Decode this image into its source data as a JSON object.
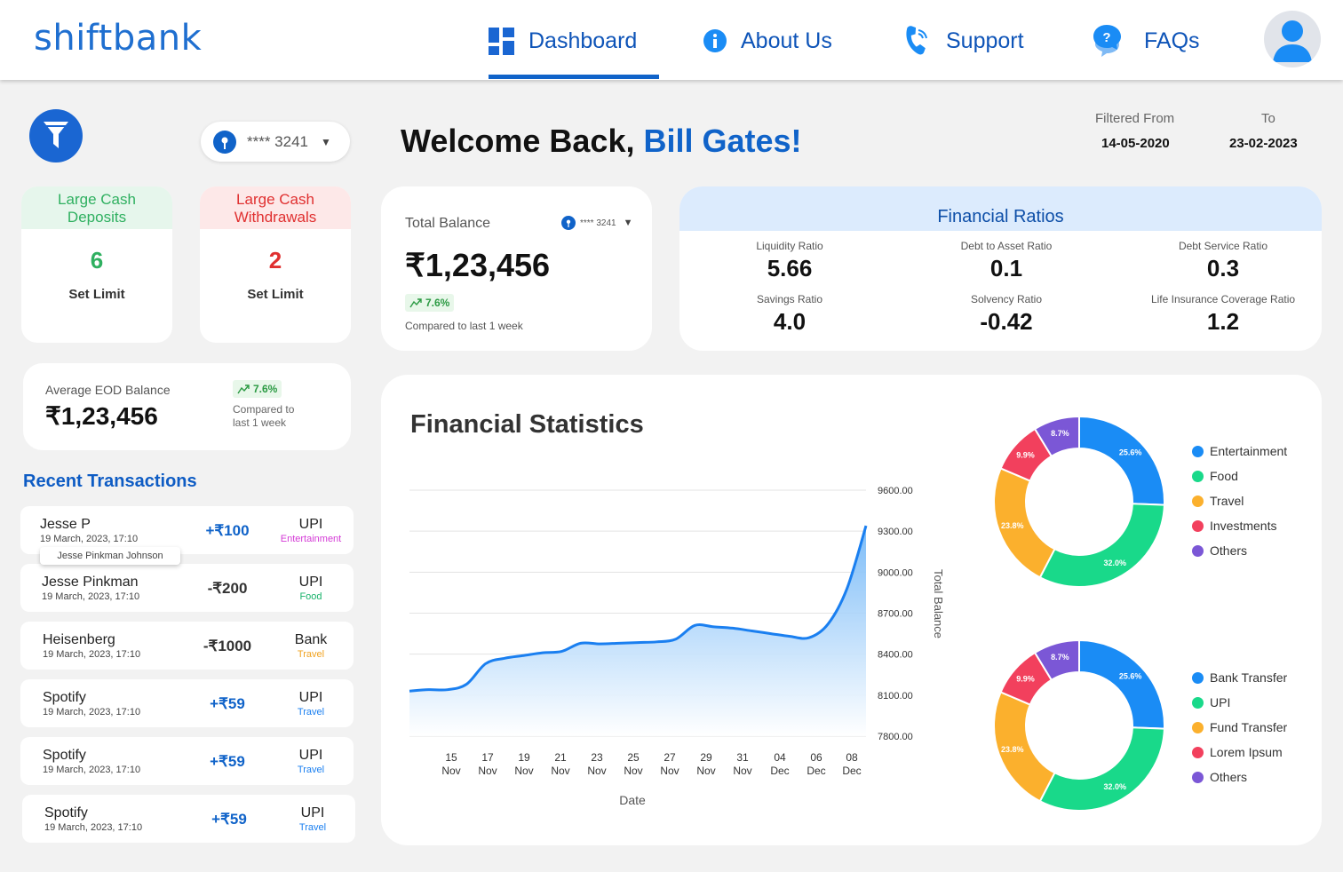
{
  "app": {
    "logo": "shiftbank"
  },
  "nav": {
    "items": [
      {
        "label": "Dashboard",
        "icon": "dashboard-icon",
        "active": true
      },
      {
        "label": "About Us",
        "icon": "info-icon"
      },
      {
        "label": "Support",
        "icon": "phone-icon"
      },
      {
        "label": "FAQs",
        "icon": "faq-icon"
      }
    ]
  },
  "account_select": {
    "value": "**** 3241"
  },
  "limits": {
    "deposits": {
      "title_line1": "Large Cash",
      "title_line2": "Deposits",
      "count": "6",
      "action": "Set Limit",
      "color": "#2fb060",
      "bg": "#e6f6ec"
    },
    "withdrawals": {
      "title_line1": "Large Cash",
      "title_line2": "Withdrawals",
      "count": "2",
      "action": "Set Limit",
      "color": "#e03030",
      "bg": "#fde8e8"
    }
  },
  "eod": {
    "label": "Average EOD Balance",
    "value": "₹1,23,456",
    "change": "7.6%",
    "compare_line1": "Compared to",
    "compare_line2": "last 1 week"
  },
  "recent": {
    "title": "Recent Transactions",
    "tooltip": "Jesse Pinkman Johnson",
    "transactions": [
      {
        "name": "Jesse P",
        "date": "19 March, 2023, 17:10",
        "amount": "+₹100",
        "mode": "UPI",
        "category": "Entertainment",
        "cat_color": "#d43ad6",
        "amt_color": "#1063c9"
      },
      {
        "name": "Jesse Pinkman",
        "date": "19 March, 2023, 17:10",
        "amount": "-₹200",
        "mode": "UPI",
        "category": "Food",
        "cat_color": "#17b26a",
        "amt_color": "#333333"
      },
      {
        "name": "Heisenberg",
        "date": "19 March, 2023, 17:10",
        "amount": "-₹1000",
        "mode": "Bank",
        "category": "Travel",
        "cat_color": "#f0a21f",
        "amt_color": "#333333"
      },
      {
        "name": "Spotify",
        "date": "19 March, 2023, 17:10",
        "amount": "+₹59",
        "mode": "UPI",
        "category": "Travel",
        "cat_color": "#1a7ff0",
        "amt_color": "#1063c9"
      },
      {
        "name": "Spotify",
        "date": "19 March, 2023, 17:10",
        "amount": "+₹59",
        "mode": "UPI",
        "category": "Travel",
        "cat_color": "#1a7ff0",
        "amt_color": "#1063c9"
      },
      {
        "name": "Spotify",
        "date": "19 March, 2023, 17:10",
        "amount": "+₹59",
        "mode": "UPI",
        "category": "Travel",
        "cat_color": "#1a7ff0",
        "amt_color": "#1063c9"
      }
    ]
  },
  "welcome": {
    "prefix": "Welcome Back, ",
    "name": "Bill Gates!"
  },
  "date_filter": {
    "from_label": "Filtered From",
    "to_label": "To",
    "from": "14-05-2020",
    "to": "23-02-2023"
  },
  "balance": {
    "label": "Total Balance",
    "account": "**** 3241",
    "value": "₹1,23,456",
    "change": "7.6%",
    "compare": "Compared to last 1 week"
  },
  "ratios": {
    "title": "Financial Ratios",
    "items": [
      {
        "label": "Liquidity Ratio",
        "value": "5.66"
      },
      {
        "label": "Debt to Asset Ratio",
        "value": "0.1"
      },
      {
        "label": "Debt Service Ratio",
        "value": "0.3"
      },
      {
        "label": "Savings Ratio",
        "value": "4.0"
      },
      {
        "label": "Solvency Ratio",
        "value": "-0.42"
      },
      {
        "label": "Life Insurance Coverage Ratio",
        "value": "1.2"
      }
    ]
  },
  "stats": {
    "title": "Financial Statistics"
  },
  "chart_data": [
    {
      "type": "area",
      "xlabel": "Date",
      "ylabel": "Total Balance",
      "ylim": [
        7800,
        9600
      ],
      "y_ticks": [
        "9600.00",
        "9300.00",
        "9000.00",
        "8700.00",
        "8400.00",
        "8100.00",
        "7800.00"
      ],
      "x_ticks": [
        [
          "15",
          "Nov"
        ],
        [
          "17",
          "Nov"
        ],
        [
          "19",
          "Nov"
        ],
        [
          "21",
          "Nov"
        ],
        [
          "23",
          "Nov"
        ],
        [
          "25",
          "Nov"
        ],
        [
          "27",
          "Nov"
        ],
        [
          "29",
          "Nov"
        ],
        [
          "31",
          "Nov"
        ],
        [
          "04",
          "Dec"
        ],
        [
          "06",
          "Dec"
        ],
        [
          "08",
          "Dec"
        ]
      ],
      "x": [
        14,
        15,
        16,
        17,
        18,
        19,
        20,
        21,
        22,
        23,
        24,
        25,
        26,
        27,
        28,
        29,
        30,
        31,
        32,
        33,
        34,
        35,
        36,
        37,
        38
      ],
      "series": [
        {
          "values": [
            8130,
            8140,
            8140,
            8180,
            8330,
            8370,
            8390,
            8410,
            8420,
            8480,
            8475,
            8480,
            8485,
            8490,
            8510,
            8610,
            8600,
            8590,
            8570,
            8550,
            8530,
            8520,
            8620,
            8880,
            9340
          ]
        }
      ],
      "color": "#1a7ff0",
      "grid": true
    },
    {
      "type": "pie",
      "donut": true,
      "labels": [
        "Entertainment",
        "Food",
        "Travel",
        "Investments",
        "Others"
      ],
      "values": [
        25.6,
        32.0,
        23.8,
        9.9,
        8.7
      ],
      "value_labels": [
        "25.6%",
        "32.0%",
        "23.8%",
        "9.9%",
        "8.7%"
      ],
      "colors": [
        "#1a8cf5",
        "#19d98a",
        "#fbb02d",
        "#f2405d",
        "#7b57d6"
      ],
      "legend": "right"
    },
    {
      "type": "pie",
      "donut": true,
      "labels": [
        "Bank Transfer",
        "UPI",
        "Fund Transfer",
        "Lorem Ipsum",
        "Others"
      ],
      "values": [
        25.6,
        32.0,
        23.8,
        9.9,
        8.7
      ],
      "value_labels": [
        "25.6%",
        "32.0%",
        "23.8%",
        "9.9%",
        "8.7%"
      ],
      "colors": [
        "#1a8cf5",
        "#19d98a",
        "#fbb02d",
        "#f2405d",
        "#7b57d6"
      ],
      "legend": "right"
    }
  ]
}
